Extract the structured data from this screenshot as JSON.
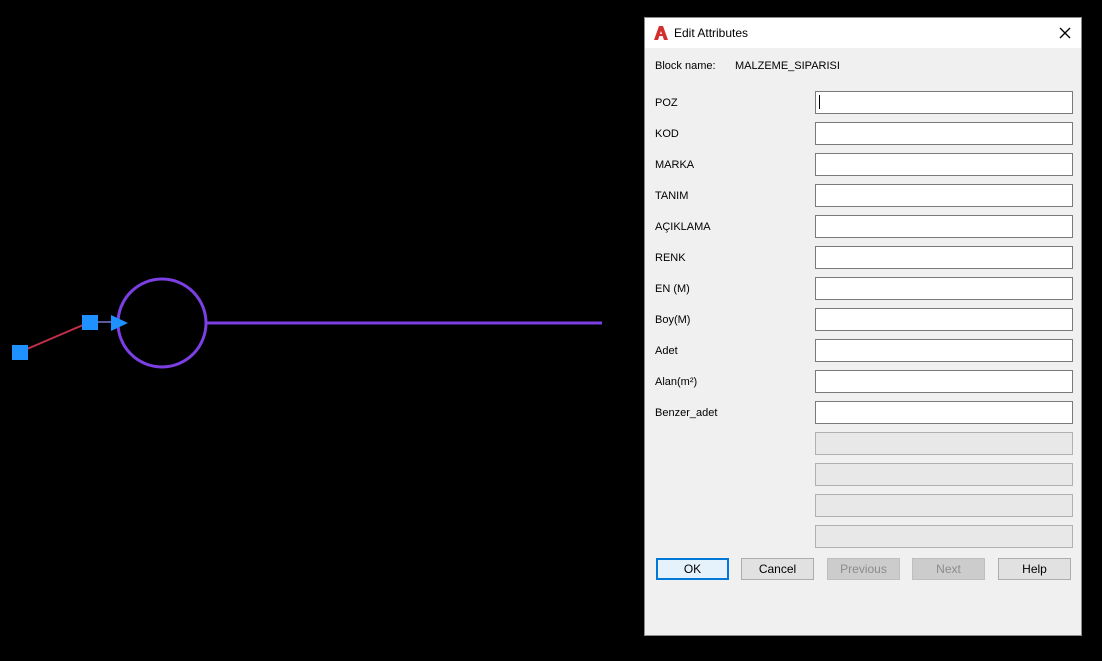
{
  "dialog": {
    "title": "Edit Attributes",
    "block_name_label": "Block name:",
    "block_name_value": "MALZEME_SIPARISI",
    "attributes": [
      {
        "label": "POZ",
        "value": ""
      },
      {
        "label": "KOD",
        "value": ""
      },
      {
        "label": "MARKA",
        "value": ""
      },
      {
        "label": "TANIM",
        "value": ""
      },
      {
        "label": "AÇIKLAMA",
        "value": ""
      },
      {
        "label": "RENK",
        "value": ""
      },
      {
        "label": "EN (M)",
        "value": ""
      },
      {
        "label": "Boy(M)",
        "value": ""
      },
      {
        "label": "Adet",
        "value": ""
      },
      {
        "label": "Alan(m²)",
        "value": ""
      },
      {
        "label": "Benzer_adet",
        "value": ""
      }
    ],
    "buttons": {
      "ok": "OK",
      "cancel": "Cancel",
      "previous": "Previous",
      "next": "Next",
      "help": "Help"
    },
    "close_icon": "close-icon",
    "app_icon": "autocad-icon"
  },
  "drawing": {
    "background": "#000000",
    "block_color": "#7b3fe4",
    "grip_color": "#1e90ff",
    "leader_color": "#c0304a"
  }
}
